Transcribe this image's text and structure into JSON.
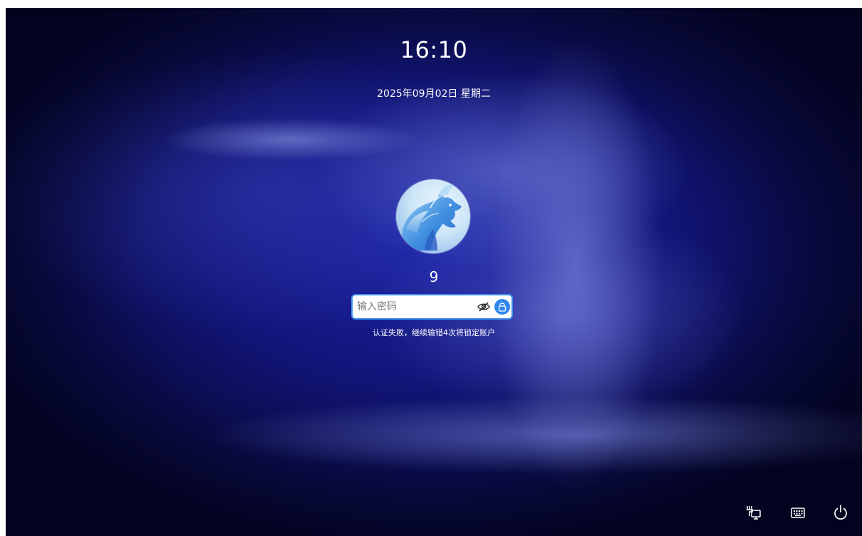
{
  "lock_screen": {
    "time": "16:10",
    "date": "2025年09月02日 星期二",
    "username": "9",
    "password_field": {
      "placeholder": "输入密码",
      "value": ""
    },
    "error_message": "认证失败，继续输错4次将锁定账户",
    "icons": {
      "visibility_toggle": "eye-hidden-icon",
      "unlock_button": "lock-icon",
      "avatar": "dragon-avatar"
    }
  },
  "tray": {
    "icons": [
      "network-wired-icon",
      "keyboard-icon",
      "power-icon"
    ]
  },
  "colors": {
    "accent": "#2f86ee",
    "input_border": "#3c8ff0",
    "background_deep": "#0a0c4a",
    "background_glow": "#1b23a6",
    "text": "#ffffff"
  }
}
